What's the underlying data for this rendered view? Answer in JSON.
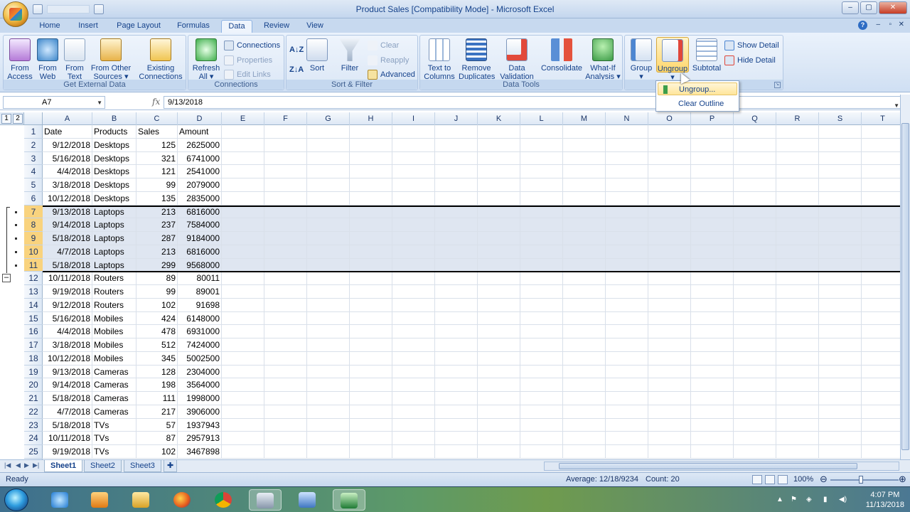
{
  "window": {
    "title": "Product Sales  [Compatibility Mode] - Microsoft Excel"
  },
  "tabs": [
    "Home",
    "Insert",
    "Page Layout",
    "Formulas",
    "Data",
    "Review",
    "View"
  ],
  "active_tab": "Data",
  "ribbon": {
    "get_external": {
      "label": "Get External Data",
      "buttons": [
        {
          "l1": "From",
          "l2": "Access"
        },
        {
          "l1": "From",
          "l2": "Web"
        },
        {
          "l1": "From",
          "l2": "Text"
        },
        {
          "l1": "From Other",
          "l2": "Sources ▾"
        },
        {
          "l1": "Existing",
          "l2": "Connections"
        }
      ]
    },
    "connections": {
      "label": "Connections",
      "refresh_l1": "Refresh",
      "refresh_l2": "All ▾",
      "small": [
        "Connections",
        "Properties",
        "Edit Links"
      ]
    },
    "sort_filter": {
      "label": "Sort & Filter",
      "sort": "Sort",
      "filter": "Filter",
      "small": [
        "Clear",
        "Reapply",
        "Advanced"
      ]
    },
    "data_tools": {
      "label": "Data Tools",
      "buttons": [
        {
          "l1": "Text to",
          "l2": "Columns"
        },
        {
          "l1": "Remove",
          "l2": "Duplicates"
        },
        {
          "l1": "Data",
          "l2": "Validation ▾"
        },
        {
          "l1": "Consolidate",
          "l2": ""
        },
        {
          "l1": "What-If",
          "l2": "Analysis ▾"
        }
      ]
    },
    "outline": {
      "group": "Group",
      "ungroup": "Ungroup",
      "subtotal": "Subtotal",
      "show_detail": "Show Detail",
      "hide_detail": "Hide Detail"
    }
  },
  "dropdown": {
    "items": [
      "Ungroup...",
      "Clear Outline"
    ]
  },
  "formula_bar": {
    "name_box": "A7",
    "fx": "fx",
    "content": "9/13/2018"
  },
  "outline_levels": [
    "1",
    "2"
  ],
  "columns": [
    "A",
    "B",
    "C",
    "D",
    "E",
    "F",
    "G",
    "H",
    "I",
    "J",
    "K",
    "L",
    "M",
    "N",
    "O",
    "P",
    "Q",
    "R",
    "S",
    "T"
  ],
  "rows": [
    [
      "Date",
      "Products",
      "Sales",
      "Amount"
    ],
    [
      "9/12/2018",
      "Desktops",
      "125",
      "2625000"
    ],
    [
      "5/16/2018",
      "Desktops",
      "321",
      "6741000"
    ],
    [
      "4/4/2018",
      "Desktops",
      "121",
      "2541000"
    ],
    [
      "3/18/2018",
      "Desktops",
      "99",
      "2079000"
    ],
    [
      "10/12/2018",
      "Desktops",
      "135",
      "2835000"
    ],
    [
      "9/13/2018",
      "Laptops",
      "213",
      "6816000"
    ],
    [
      "9/14/2018",
      "Laptops",
      "237",
      "7584000"
    ],
    [
      "5/18/2018",
      "Laptops",
      "287",
      "9184000"
    ],
    [
      "4/7/2018",
      "Laptops",
      "213",
      "6816000"
    ],
    [
      "5/18/2018",
      "Laptops",
      "299",
      "9568000"
    ],
    [
      "10/11/2018",
      "Routers",
      "89",
      "80011"
    ],
    [
      "9/19/2018",
      "Routers",
      "99",
      "89001"
    ],
    [
      "9/12/2018",
      "Routers",
      "102",
      "91698"
    ],
    [
      "5/16/2018",
      "Mobiles",
      "424",
      "6148000"
    ],
    [
      "4/4/2018",
      "Mobiles",
      "478",
      "6931000"
    ],
    [
      "3/18/2018",
      "Mobiles",
      "512",
      "7424000"
    ],
    [
      "10/12/2018",
      "Mobiles",
      "345",
      "5002500"
    ],
    [
      "9/13/2018",
      "Cameras",
      "128",
      "2304000"
    ],
    [
      "9/14/2018",
      "Cameras",
      "198",
      "3564000"
    ],
    [
      "5/18/2018",
      "Cameras",
      "111",
      "1998000"
    ],
    [
      "4/7/2018",
      "Cameras",
      "217",
      "3906000"
    ],
    [
      "5/18/2018",
      "TVs",
      "57",
      "1937943"
    ],
    [
      "10/11/2018",
      "TVs",
      "87",
      "2957913"
    ],
    [
      "9/19/2018",
      "TVs",
      "102",
      "3467898"
    ]
  ],
  "selected_rows": [
    7,
    8,
    9,
    10,
    11
  ],
  "sheets": [
    "Sheet1",
    "Sheet2",
    "Sheet3"
  ],
  "active_sheet": "Sheet1",
  "status": {
    "ready": "Ready",
    "average": "Average: 12/18/9234",
    "count": "Count: 20",
    "zoom": "100%"
  },
  "clock": {
    "time": "4:07 PM",
    "date": "11/13/2018"
  },
  "colors": {
    "accent": "#15428b",
    "selected_row_header": "#f9d37e",
    "selection_fill": "#dfe6f1"
  }
}
